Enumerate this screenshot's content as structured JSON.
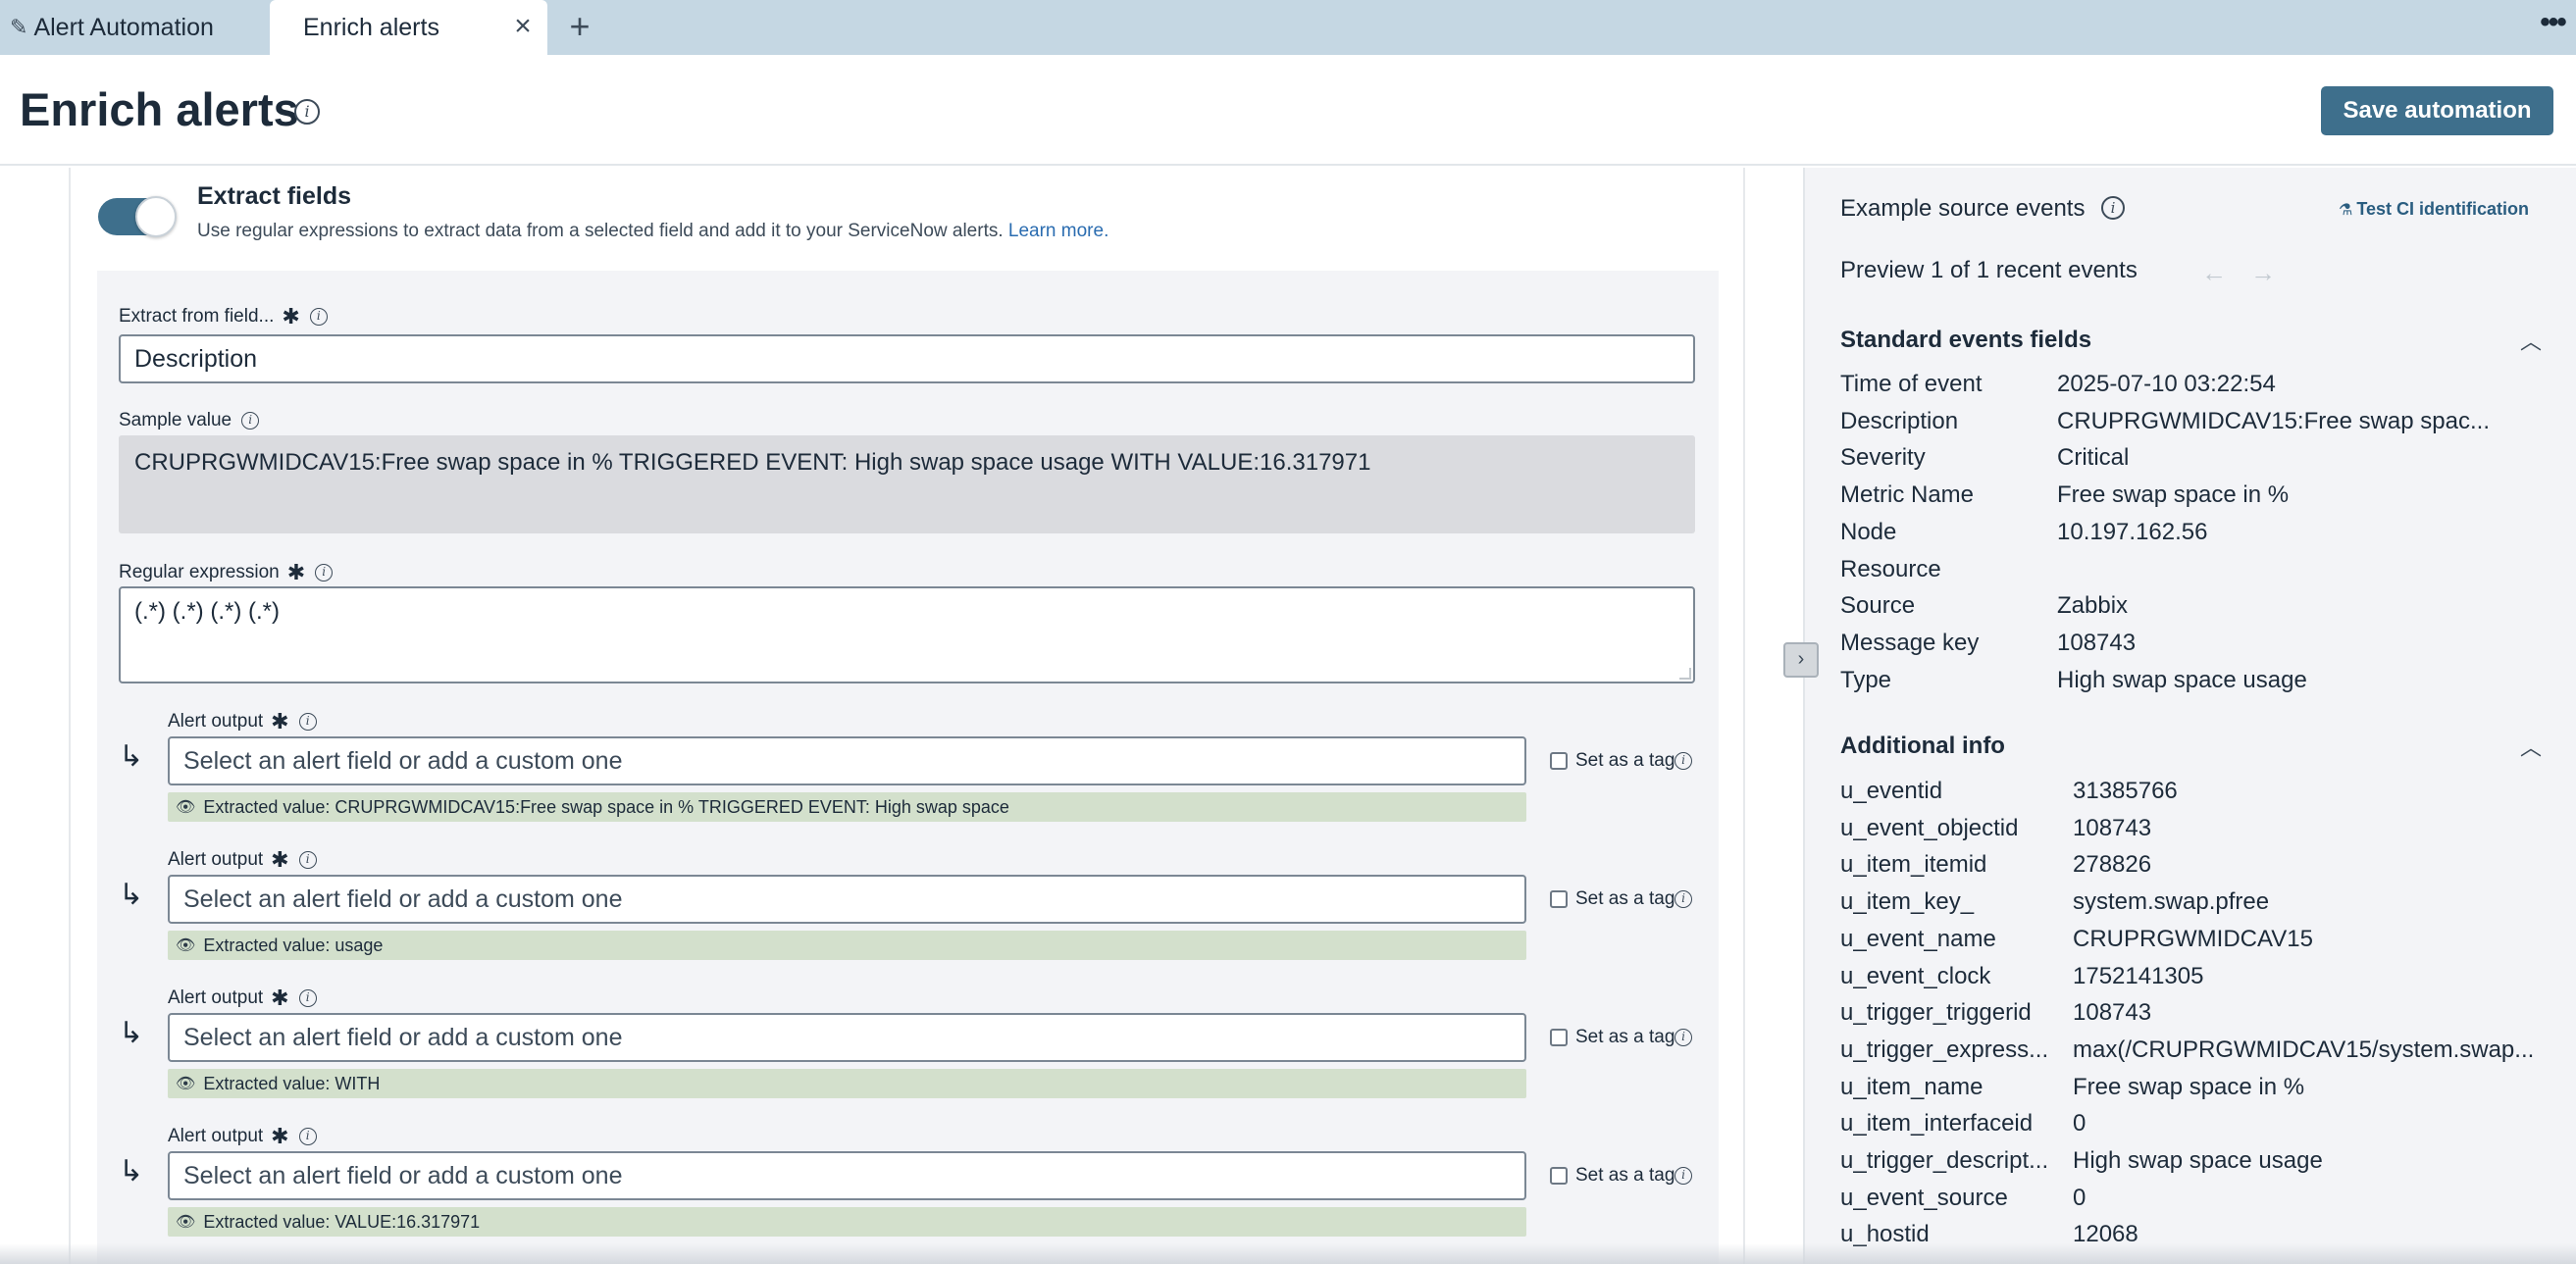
{
  "tabs": [
    {
      "label": "Alert Automation",
      "icon": "pencil-icon"
    },
    {
      "label": "Enrich alerts",
      "active": true
    }
  ],
  "tab_close": "×",
  "tab_add": "+",
  "tab_more": "•••",
  "page_title": "Enrich alerts",
  "save_button": "Save automation",
  "extract": {
    "title": "Extract fields",
    "description": "Use regular expressions to extract data from a selected field and add it to your ServiceNow alerts.",
    "learn_more": "Learn more.",
    "field_label": "Extract from field...",
    "field_value": "Description",
    "sample_label": "Sample value",
    "sample_value": "CRUPRGWMIDCAV15:Free swap space in % TRIGGERED EVENT: High swap space usage WITH VALUE:16.317971",
    "regex_label": "Regular expression",
    "regex_value": "(.*) (.*) (.*) (.*)",
    "required_mark": "✱",
    "outputs": [
      {
        "label": "Alert output",
        "placeholder": "Select an alert field or add a custom one",
        "tag_label": "Set as a tag",
        "extracted": "Extracted value: CRUPRGWMIDCAV15:Free swap space in % TRIGGERED EVENT: High swap space"
      },
      {
        "label": "Alert output",
        "placeholder": "Select an alert field or add a custom one",
        "tag_label": "Set as a tag",
        "extracted": "Extracted value: usage"
      },
      {
        "label": "Alert output",
        "placeholder": "Select an alert field or add a custom one",
        "tag_label": "Set as a tag",
        "extracted": "Extracted value: WITH"
      },
      {
        "label": "Alert output",
        "placeholder": "Select an alert field or add a custom one",
        "tag_label": "Set as a tag",
        "extracted": "Extracted value: VALUE:16.317971"
      }
    ]
  },
  "right": {
    "title": "Example source events",
    "test_ci": "Test CI identification",
    "preview": "Preview 1 of 1 recent events",
    "standard_title": "Standard events fields",
    "standard_fields": [
      {
        "key": "Time of event",
        "value": "2025-07-10 03:22:54"
      },
      {
        "key": "Description",
        "value": "CRUPRGWMIDCAV15:Free swap spac..."
      },
      {
        "key": "Severity",
        "value": "Critical"
      },
      {
        "key": "Metric Name",
        "value": "Free swap space in %"
      },
      {
        "key": "Node",
        "value": "10.197.162.56"
      },
      {
        "key": "Resource",
        "value": ""
      },
      {
        "key": "Source",
        "value": "Zabbix"
      },
      {
        "key": "Message key",
        "value": "108743"
      },
      {
        "key": "Type",
        "value": "High swap space usage"
      }
    ],
    "additional_title": "Additional info",
    "additional_fields": [
      {
        "key": "u_eventid",
        "value": "31385766"
      },
      {
        "key": "u_event_objectid",
        "value": "108743"
      },
      {
        "key": "u_item_itemid",
        "value": "278826"
      },
      {
        "key": "u_item_key_",
        "value": "system.swap.pfree"
      },
      {
        "key": "u_event_name",
        "value": "CRUPRGWMIDCAV15"
      },
      {
        "key": "u_event_clock",
        "value": "1752141305"
      },
      {
        "key": "u_trigger_triggerid",
        "value": "108743"
      },
      {
        "key": "u_trigger_express...",
        "value": "max(/CRUPRGWMIDCAV15/system.swap..."
      },
      {
        "key": "u_item_name",
        "value": "Free swap space in %"
      },
      {
        "key": "u_item_interfaceid",
        "value": "0"
      },
      {
        "key": "u_trigger_descript...",
        "value": "High swap space usage"
      },
      {
        "key": "u_event_source",
        "value": "0"
      },
      {
        "key": "u_hostid",
        "value": "12068"
      }
    ]
  }
}
